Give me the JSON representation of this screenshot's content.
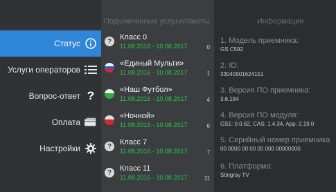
{
  "menu": {
    "items": [
      {
        "label": "Статус",
        "icon": "info-icon",
        "active": true
      },
      {
        "label": "Услуги операторов",
        "icon": "list-icon",
        "active": false
      },
      {
        "label": "Вопрос-ответ",
        "icon": "question-mark-icon",
        "active": false
      },
      {
        "label": "Оплата",
        "icon": "card-icon",
        "active": false
      },
      {
        "label": "Настройки",
        "icon": "gear-icon",
        "active": false
      }
    ]
  },
  "services": {
    "header": "Подключенные услуги/пакеты",
    "rows": [
      {
        "name": "Класс 0",
        "date": "11.08.2016 - 10.08.2017",
        "count": "0",
        "icon": "question-icon"
      },
      {
        "name": "«Единый Мульти»",
        "date": "11.08.2016 - 10.08.2017",
        "count": "1",
        "icon": "tricolor-ball-icon"
      },
      {
        "name": "«Наш Футбол»",
        "date": "11.08.2016 - 10.08.2017",
        "count": "4",
        "icon": "green-ball-icon"
      },
      {
        "name": "«Ночной»",
        "date": "11.08.2016 - 10.08.2017",
        "count": "6",
        "icon": "red-ball-icon"
      },
      {
        "name": "Класс 7",
        "date": "11.08.2016 - 10.08.2017",
        "count": "7",
        "icon": "question-icon"
      },
      {
        "name": "Класс 11",
        "date": "11.08.2016 - 10.08.2017",
        "count": "11",
        "icon": "question-icon"
      }
    ]
  },
  "info": {
    "header": "Информация",
    "items": [
      {
        "label": "1. Модель приемника:",
        "value": "GS C592"
      },
      {
        "label": "2. ID:",
        "value": "33040901624151"
      },
      {
        "label": "3. Версия ПО приемника:",
        "value": "3.6.184"
      },
      {
        "label": "4. Версия ПО модуля:",
        "value": "GS1: 0.0.62, CAS: 1.4.34, App: 2.19.0"
      },
      {
        "label": "5. Серийный номер приемника",
        "value": "00 0000 00 00 00 000 00000000"
      },
      {
        "label": "6. Платформа:",
        "value": "Stingray TV"
      }
    ]
  },
  "colors": {
    "accent": "#2f86d9",
    "date": "#27c94a"
  }
}
